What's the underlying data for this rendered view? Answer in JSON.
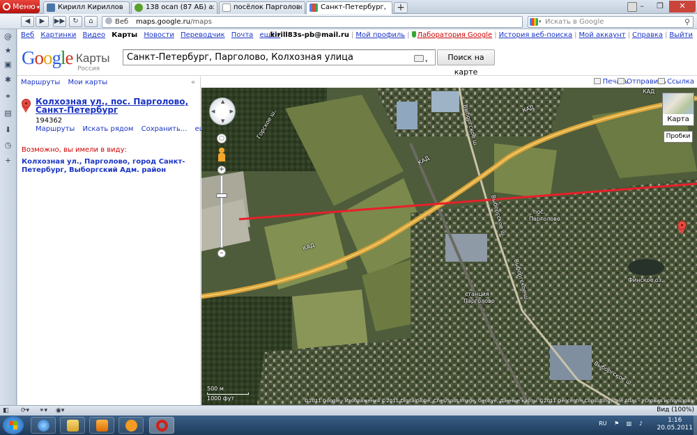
{
  "browser": {
    "menu_label": "Меню",
    "tabs": [
      {
        "label": "Кирилл Кириллов",
        "icon_color": "#4a76a8"
      },
      {
        "label": "138 осап (87 АБ) аэр. ...",
        "icon_color": "#5aa02c"
      },
      {
        "label": "посёлок Парголово, ...",
        "icon_color": "#ffffff"
      },
      {
        "label": "Санкт-Петербург, Пар...",
        "icon_color": "#ffffff"
      }
    ],
    "address_prefix": "Веб",
    "address_domain": "maps.google.ru",
    "address_path": "/maps",
    "search_placeholder": "Искать в Google",
    "zoom_status": "Вид (100%)"
  },
  "gbar": {
    "links": [
      "Веб",
      "Картинки",
      "Видео",
      "Карты",
      "Новости",
      "Переводчик",
      "Почта",
      "ещё ▾"
    ],
    "current": "Карты",
    "user": "kirill83s-pb@mail.ru",
    "right_links": [
      "Мой профиль",
      "Лаборатория Google",
      "История веб-поиска",
      "Мой аккаунт",
      "Справка",
      "Выйти"
    ]
  },
  "header": {
    "logo_letters": [
      "G",
      "o",
      "o",
      "g",
      "l",
      "e"
    ],
    "service": "Карты",
    "country": "Россия",
    "query": "Санкт-Петербург, Парголово, Колхозная улица",
    "search_button": "Поиск на карте"
  },
  "left": {
    "links": [
      "Маршруты",
      "Мои карты"
    ],
    "collapse": "«",
    "result_title": "Колхозная ул., пос. Парголово, Санкт-Петербург",
    "result_zip": "194362",
    "result_actions": [
      "Маршруты",
      "Искать рядом",
      "Сохранить...",
      "ещё▼"
    ],
    "didyoumean": "Возможно, вы имели в виду:",
    "suggestion": "Колхозная ул., Парголово, город Санкт-Петербург, Выборгский Адм. район"
  },
  "maptools": {
    "print": "Печать",
    "send": "Отправить",
    "link": "Ссылка"
  },
  "map": {
    "type_label": "Карта",
    "traffic_label": "Пробки",
    "scale_top": "500 м",
    "scale_bottom": "1000 фут",
    "copyright": "©2011 Google - Изображения ©2011 DigitalGlobe, Cnes/Spot Image, GeoEye, Данные карты ©2011 Geocentre Consulting, Tele Atlas - Условия использования",
    "labels": {
      "kad1": "КАД",
      "kad2": "КАД",
      "kad3": "КАД",
      "kad4": "КАД",
      "pos": "пос.",
      "pargolovo": "Парголово",
      "station": "станция",
      "station_name": "Парголово",
      "lake": "Финское оз.",
      "vyb1": "Выборгское ш.",
      "vyb2": "Выборгское ш.",
      "vyb3": "Выборгское ш.",
      "vyb4": "Выборгское ш.",
      "gorskoe": "Горское ш."
    }
  },
  "taskbar": {
    "lang": "RU",
    "time": "1:16",
    "date": "20.05.2011"
  },
  "colors": {
    "route_line": "#e8202a",
    "link": "#1a33c4",
    "road": "#e7b33a"
  }
}
